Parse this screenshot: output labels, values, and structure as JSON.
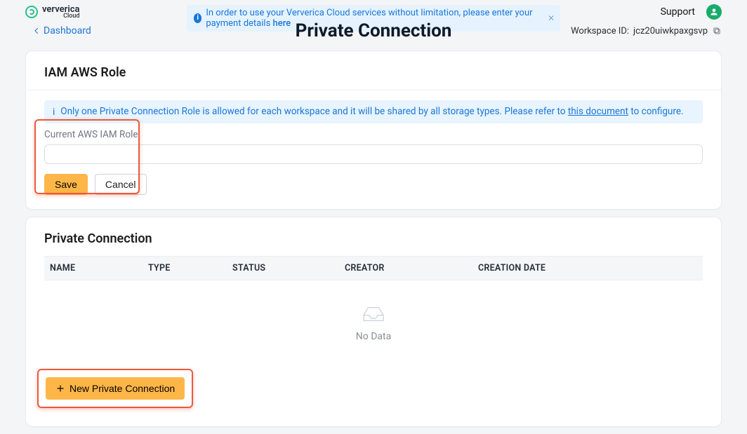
{
  "brand": {
    "name": "ververica",
    "sub": "Cloud"
  },
  "banner": {
    "text_prefix": "In order to use your Ververica Cloud services without limitation, please enter your payment details ",
    "link_text": "here"
  },
  "top": {
    "support": "Support"
  },
  "subheader": {
    "back_label": "Dashboard",
    "title": "Private Connection",
    "workspace_label": "Workspace ID:",
    "workspace_value": "jcz20uiwkpaxgsvp"
  },
  "iam_card": {
    "title": "IAM AWS Role",
    "alert_prefix": "Only one Private Connection Role is allowed for each workspace and it will be shared by all storage types. Please refer to ",
    "alert_link": "this document",
    "alert_suffix": " to configure.",
    "field_label": "Current AWS IAM Role:",
    "value": "",
    "save": "Save",
    "cancel": "Cancel"
  },
  "conn_card": {
    "title": "Private Connection",
    "columns": {
      "name": "NAME",
      "type": "TYPE",
      "status": "STATUS",
      "creator": "CREATOR",
      "creation_date": "CREATION DATE"
    },
    "empty": "No Data",
    "new_button": "New Private Connection"
  }
}
